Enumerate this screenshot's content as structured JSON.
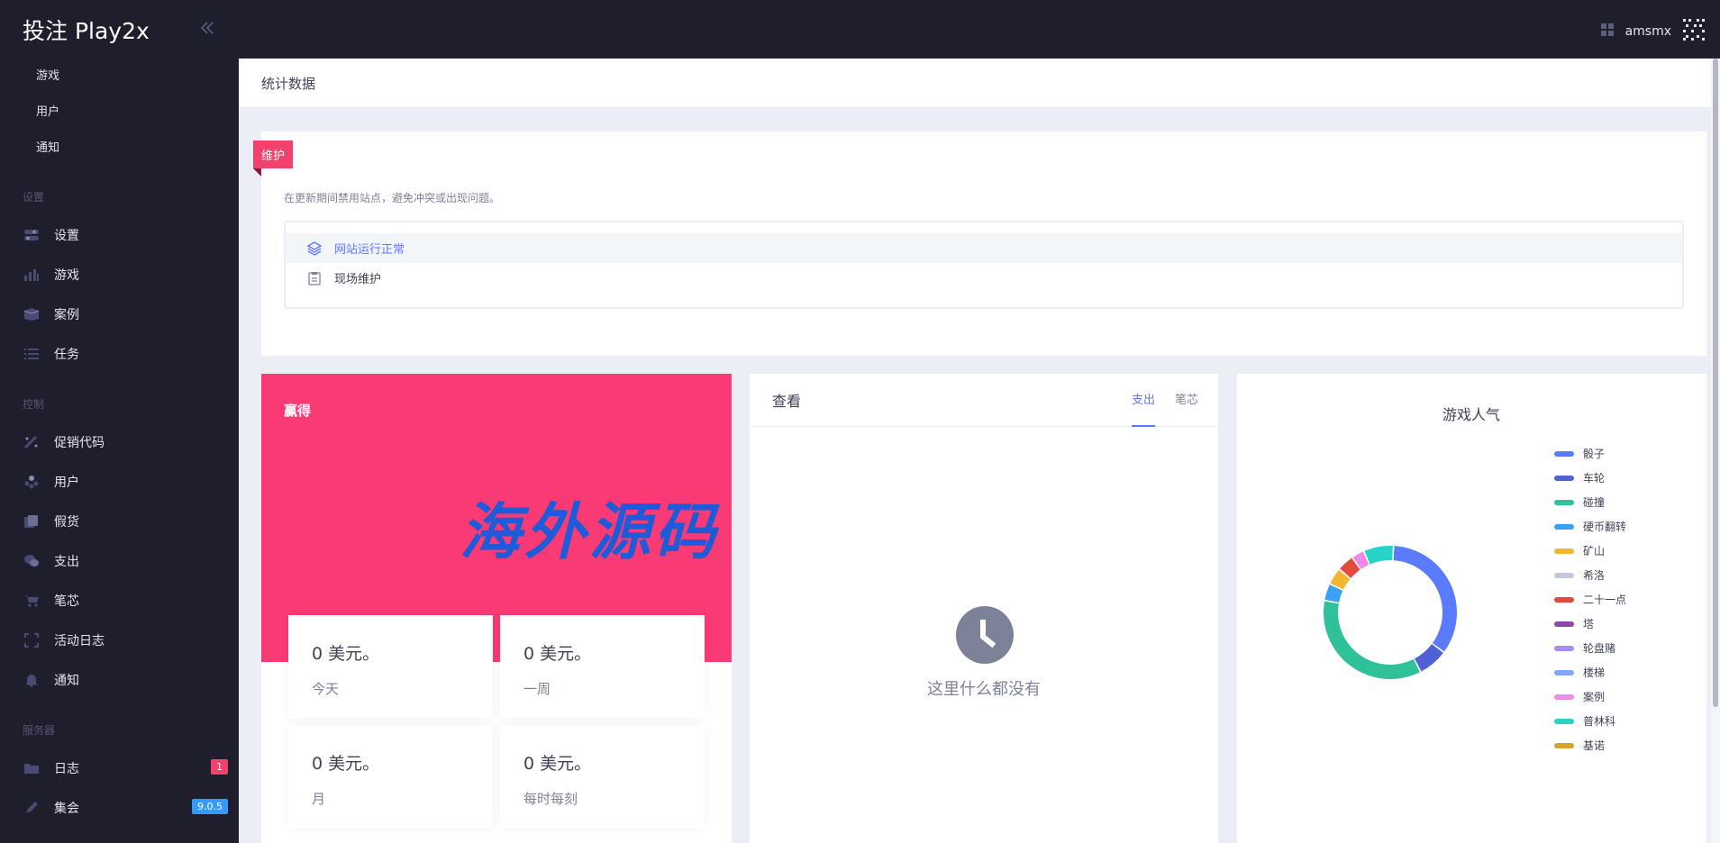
{
  "app": {
    "title": "投注 Play2x",
    "collapse_icon": "double-chevron-left"
  },
  "sidebar": {
    "top_links": [
      {
        "label": "游戏"
      },
      {
        "label": "用户"
      },
      {
        "label": "通知"
      }
    ],
    "sections": [
      {
        "label": "设置",
        "items": [
          {
            "label": "设置",
            "icon": "toggle-icon"
          },
          {
            "label": "游戏",
            "icon": "bar-chart-icon"
          },
          {
            "label": "案例",
            "icon": "box-icon"
          },
          {
            "label": "任务",
            "icon": "list-icon"
          }
        ]
      },
      {
        "label": "控制",
        "items": [
          {
            "label": "促销代码",
            "icon": "wand-icon"
          },
          {
            "label": "用户",
            "icon": "users-icon"
          },
          {
            "label": "假货",
            "icon": "cards-icon"
          },
          {
            "label": "支出",
            "icon": "chat-icon"
          },
          {
            "label": "笔芯",
            "icon": "cart-icon"
          },
          {
            "label": "活动日志",
            "icon": "expand-icon"
          },
          {
            "label": "通知",
            "icon": "bell-icon"
          }
        ]
      },
      {
        "label": "服务器",
        "items": [
          {
            "label": "日志",
            "icon": "folder-icon",
            "badge": "1"
          },
          {
            "label": "集会",
            "icon": "pen-icon",
            "badge": "9.0.5"
          }
        ]
      }
    ]
  },
  "header": {
    "username": "amsmx"
  },
  "subheader": {
    "title": "统计数据"
  },
  "maintenance": {
    "ribbon": "维护",
    "description": "在更新期间禁用站点，避免冲突或出现问题。",
    "options": [
      {
        "label": "网站运行正常",
        "icon": "layers-icon",
        "active": true
      },
      {
        "label": "现场维护",
        "icon": "clipboard-icon",
        "active": false
      }
    ]
  },
  "wins": {
    "title": "赢得",
    "watermark": "海外源码",
    "stats": [
      {
        "value": "0 美元。",
        "label": "今天"
      },
      {
        "value": "0 美元。",
        "label": "一周"
      },
      {
        "value": "0 美元。",
        "label": "月"
      },
      {
        "value": "0 美元。",
        "label": "每时每刻"
      }
    ]
  },
  "view": {
    "title": "查看",
    "tabs": [
      "支出",
      "笔芯"
    ],
    "active_tab": "支出",
    "empty_text": "这里什么都没有"
  },
  "popularity": {
    "title": "游戏人气",
    "colors": {
      "骰子": "#5b7bff",
      "车轮": "#5061d6",
      "碰撞": "#2fc19a",
      "硬币翻转": "#3aa1f2",
      "矿山": "#f2b52f",
      "希洛": "#c4c8dd",
      "二十一点": "#e04b3c",
      "塔": "#8e44ad",
      "轮盘赌": "#a78bfa",
      "楼梯": "#7ea6ff",
      "案例": "#f089e8",
      "普林科": "#27d3c9",
      "基诺": "#d4a52a"
    }
  },
  "chart_data": {
    "type": "pie",
    "title": "游戏人气",
    "legend": "right",
    "categories": [
      "骰子",
      "车轮",
      "碰撞",
      "硬币翻转",
      "矿山",
      "希洛",
      "二十一点",
      "塔",
      "轮盘赌",
      "楼梯",
      "案例",
      "普林科",
      "基诺"
    ],
    "values": [
      33,
      7,
      34,
      4,
      4,
      0,
      4,
      0,
      0,
      0,
      3,
      7,
      0
    ],
    "donut": true
  }
}
